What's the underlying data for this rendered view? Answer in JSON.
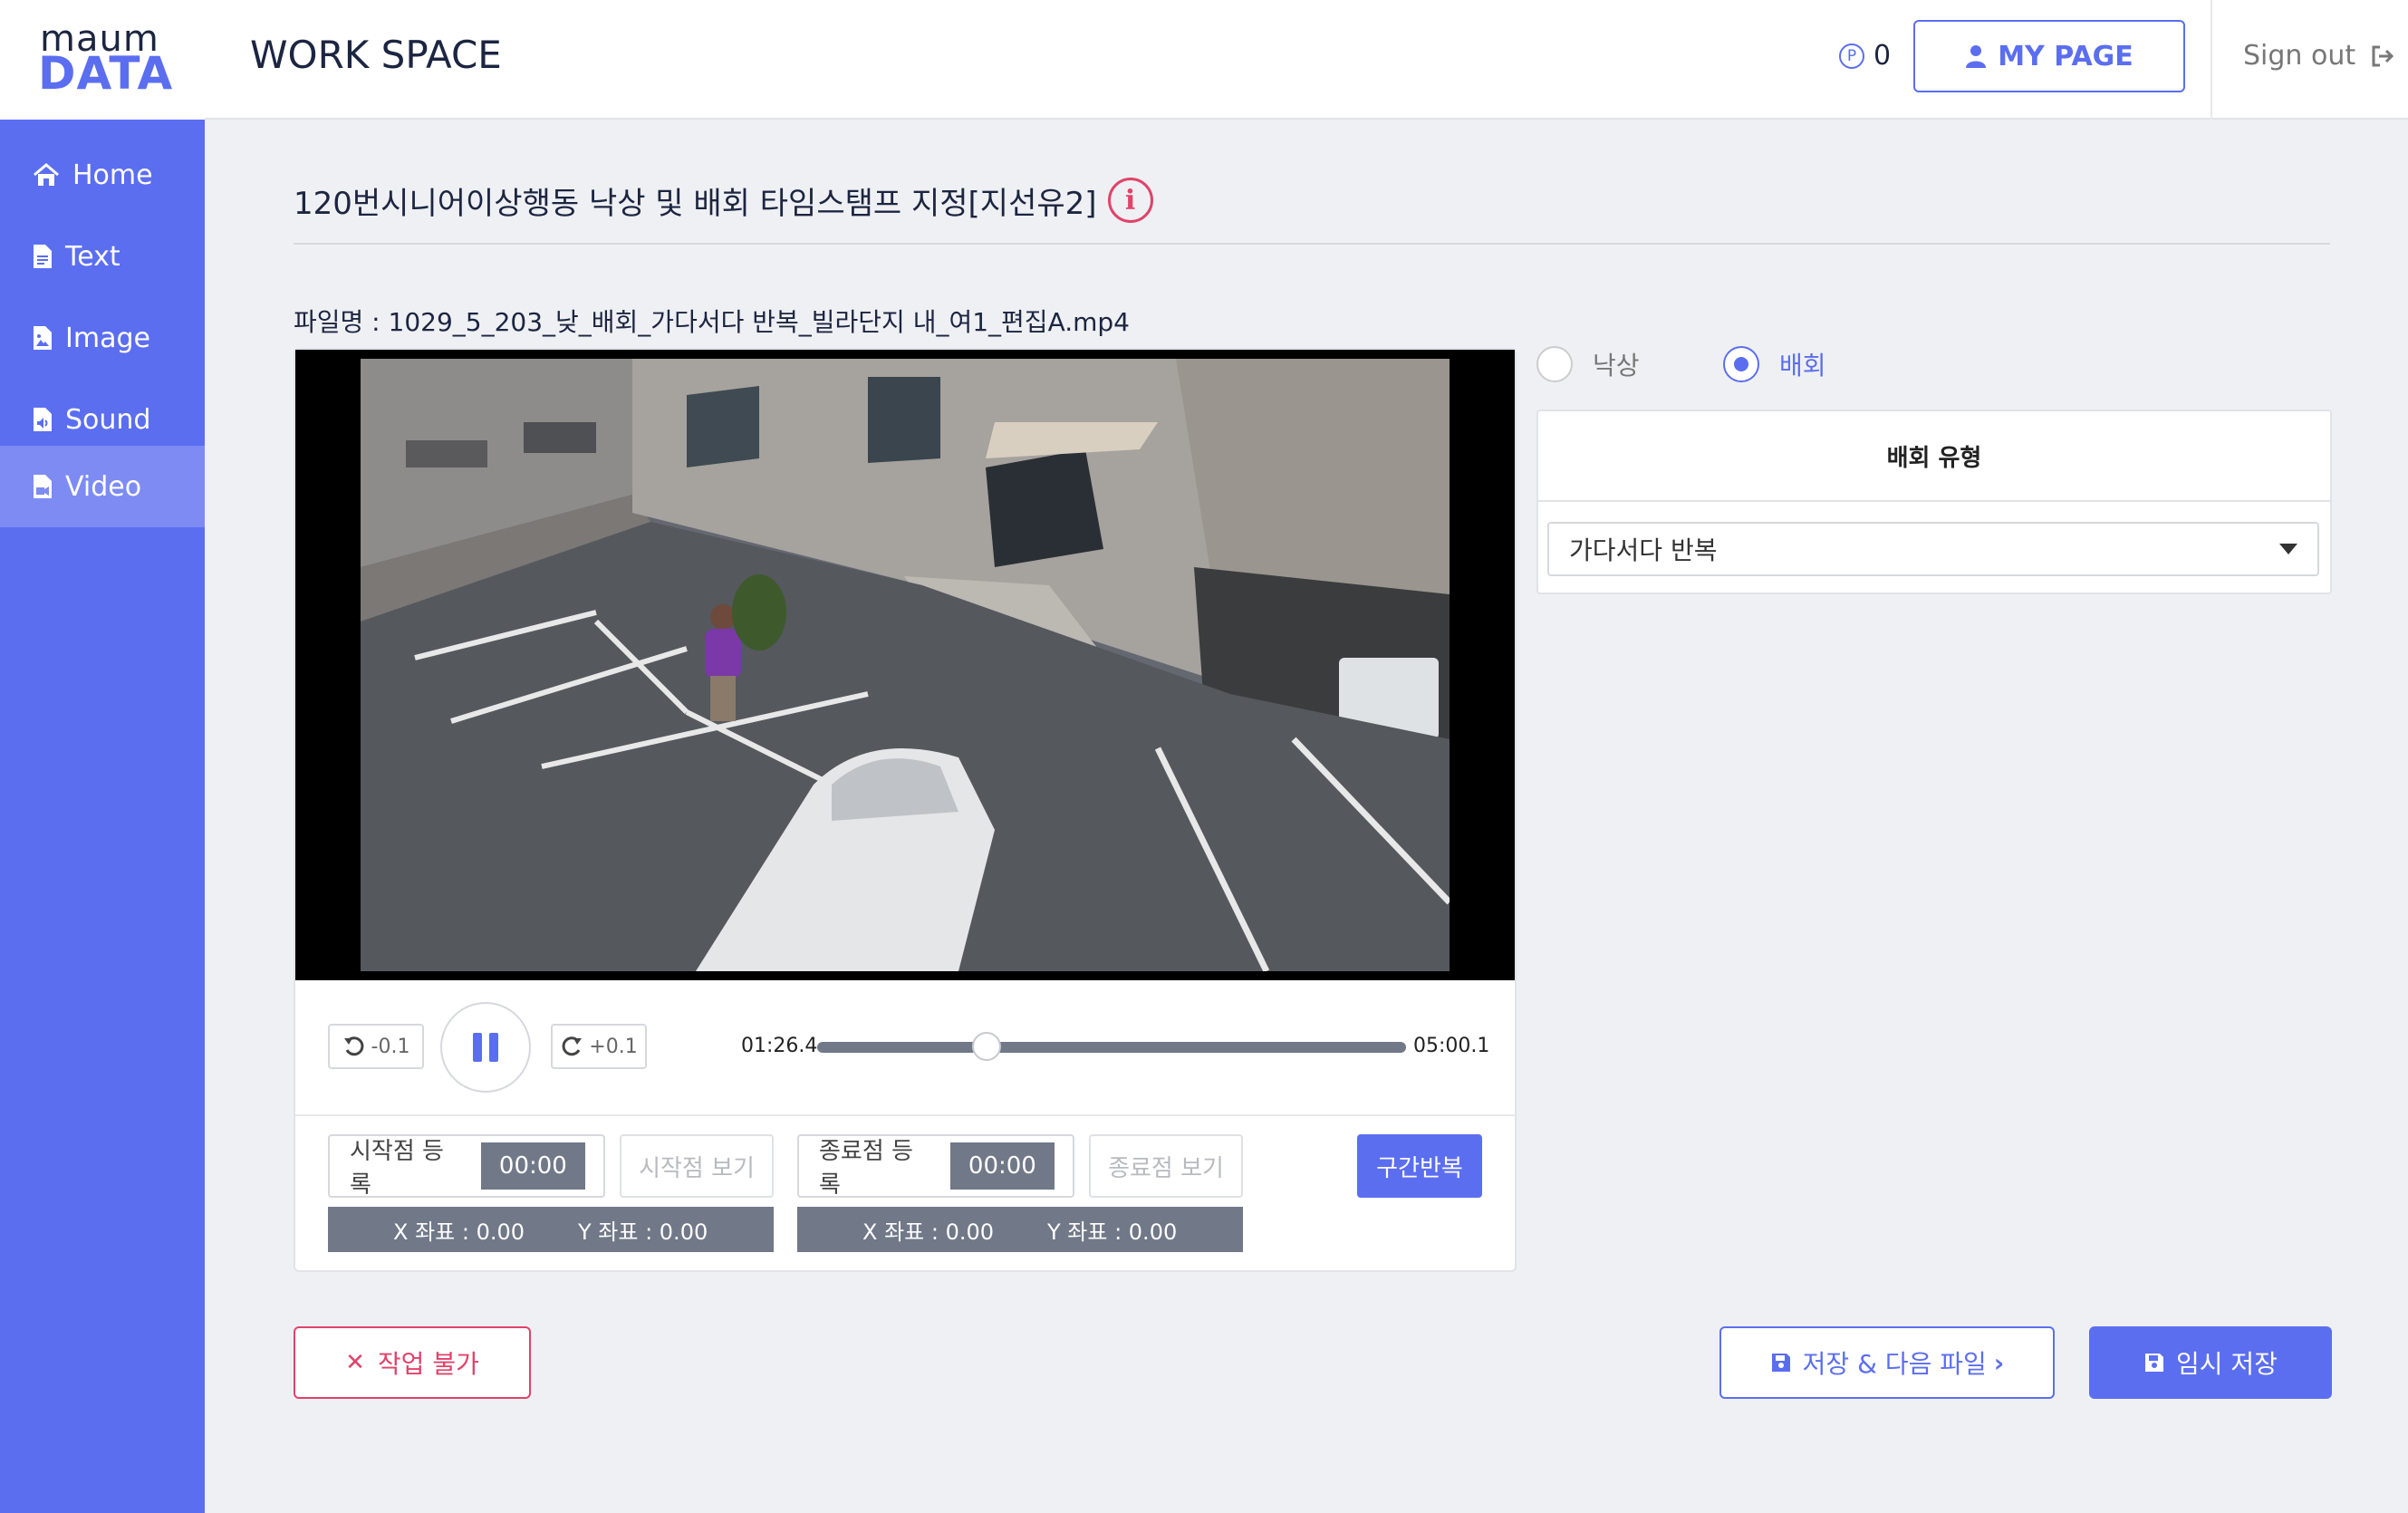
{
  "logo": {
    "line1": "maum",
    "line2": "DATA"
  },
  "header": {
    "title": "WORK SPACE",
    "points_symbol": "P",
    "points": "0",
    "mypage_label": "MY PAGE",
    "signout_label": "Sign out"
  },
  "sidebar": {
    "items": [
      {
        "label": "Home",
        "icon": "home-icon"
      },
      {
        "label": "Text",
        "icon": "file-text-icon"
      },
      {
        "label": "Image",
        "icon": "file-image-icon"
      },
      {
        "label": "Sound",
        "icon": "file-audio-icon"
      },
      {
        "label": "Video",
        "icon": "file-video-icon",
        "active": true
      }
    ]
  },
  "task": {
    "title": "120번시니어이상행동 낙상 및 배회 타임스탬프 지정[지선유2]",
    "info_symbol": "i",
    "filename": "파일명 : 1029_5_203_낮_배회_가다서다 반복_빌라단지 내_여1_편집A.mp4"
  },
  "player": {
    "back_label": "-0.1",
    "fwd_label": "+0.1",
    "current_time": "01:26.4",
    "duration": "05:00.1",
    "progress": 0.288
  },
  "markers": {
    "start": {
      "register_label": "시작점 등록",
      "time": "00:00",
      "view_label": "시작점 보기",
      "x_coord": "X 좌표 : 0.00",
      "y_coord": "Y 좌표 : 0.00"
    },
    "end": {
      "register_label": "종료점 등록",
      "time": "00:00",
      "view_label": "종료점 보기",
      "x_coord": "X 좌표 : 0.00",
      "y_coord": "Y 좌표 : 0.00"
    },
    "loop_label": "구간반복"
  },
  "classification": {
    "options": [
      {
        "label": "낙상",
        "selected": false
      },
      {
        "label": "배회",
        "selected": true
      }
    ],
    "type_header": "배회 유형",
    "type_value": "가다서다 반복"
  },
  "actions": {
    "unable_label": "작업 불가",
    "unable_symbol": "✕",
    "save_next_label": "저장 & 다음 파일",
    "save_next_symbol": "›",
    "temp_save_label": "임시 저장"
  },
  "colors": {
    "accent": "#5b6ef0",
    "danger": "#e0436a",
    "sidebar": "#5b6ef0",
    "sidebar_active": "#7d8bf3",
    "control_gray": "#717888"
  }
}
